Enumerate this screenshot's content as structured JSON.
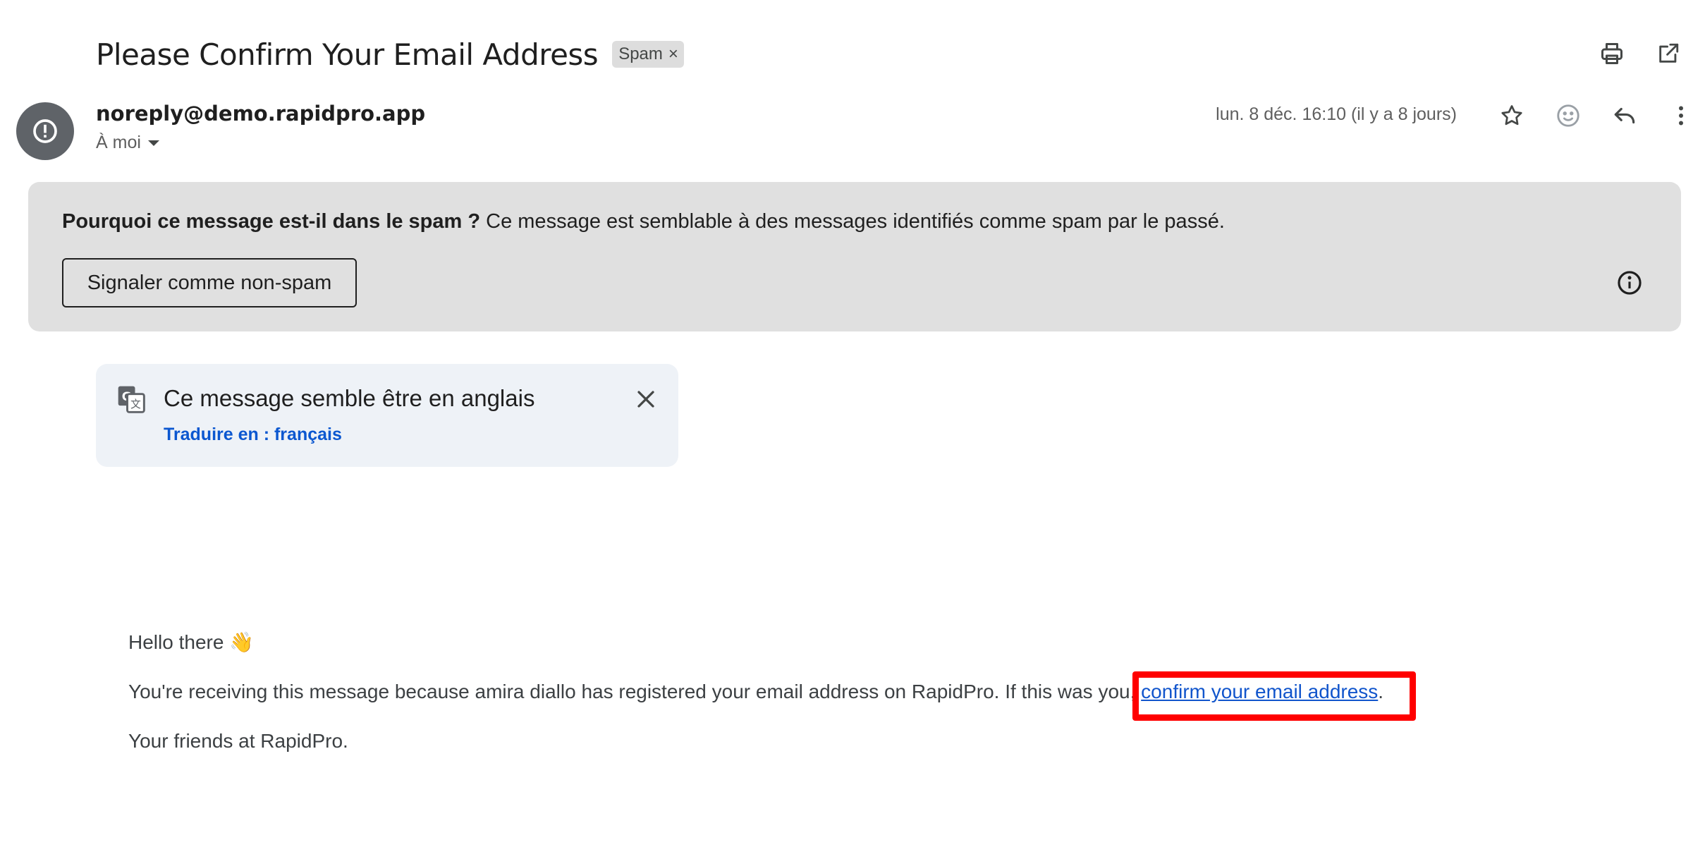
{
  "email": {
    "subject": "Please Confirm Your Email Address",
    "label_chip": "Spam",
    "label_chip_remove": "×",
    "sender": "noreply@demo.rapidpro.app",
    "recipient": "À moi",
    "date": "lun. 8 déc. 16:10 (il y a 8 jours)"
  },
  "icons": {
    "print": "print-icon",
    "open_new_window": "open-in-new-window-icon",
    "avatar": "spam-warning-icon",
    "star": "star-icon",
    "emoji": "emoji-reaction-icon",
    "reply": "reply-icon",
    "more": "more-vert-icon",
    "info": "info-icon",
    "translate": "translate-icon",
    "close": "close-icon"
  },
  "spam_warning": {
    "question": "Pourquoi ce message est-il dans le spam ?",
    "explanation": " Ce message est semblable à des messages identifiés comme spam par le passé.",
    "not_spam_button": "Signaler comme non-spam"
  },
  "translate": {
    "title": "Ce message semble être en anglais",
    "link": "Traduire en : français"
  },
  "body": {
    "greeting": "Hello there 👋",
    "line_prefix": "You're receiving this message because amira diallo has registered your email address on RapidPro. If this was you, ",
    "link": "confirm your email address",
    "line_suffix": ".",
    "signoff": "Your friends at RapidPro."
  },
  "colors": {
    "highlight": "#ff0000",
    "link": "#1155cc",
    "translate_link": "#0b57d0",
    "warning_bg": "#e0e0e0",
    "translate_bg": "#eef2f7"
  }
}
